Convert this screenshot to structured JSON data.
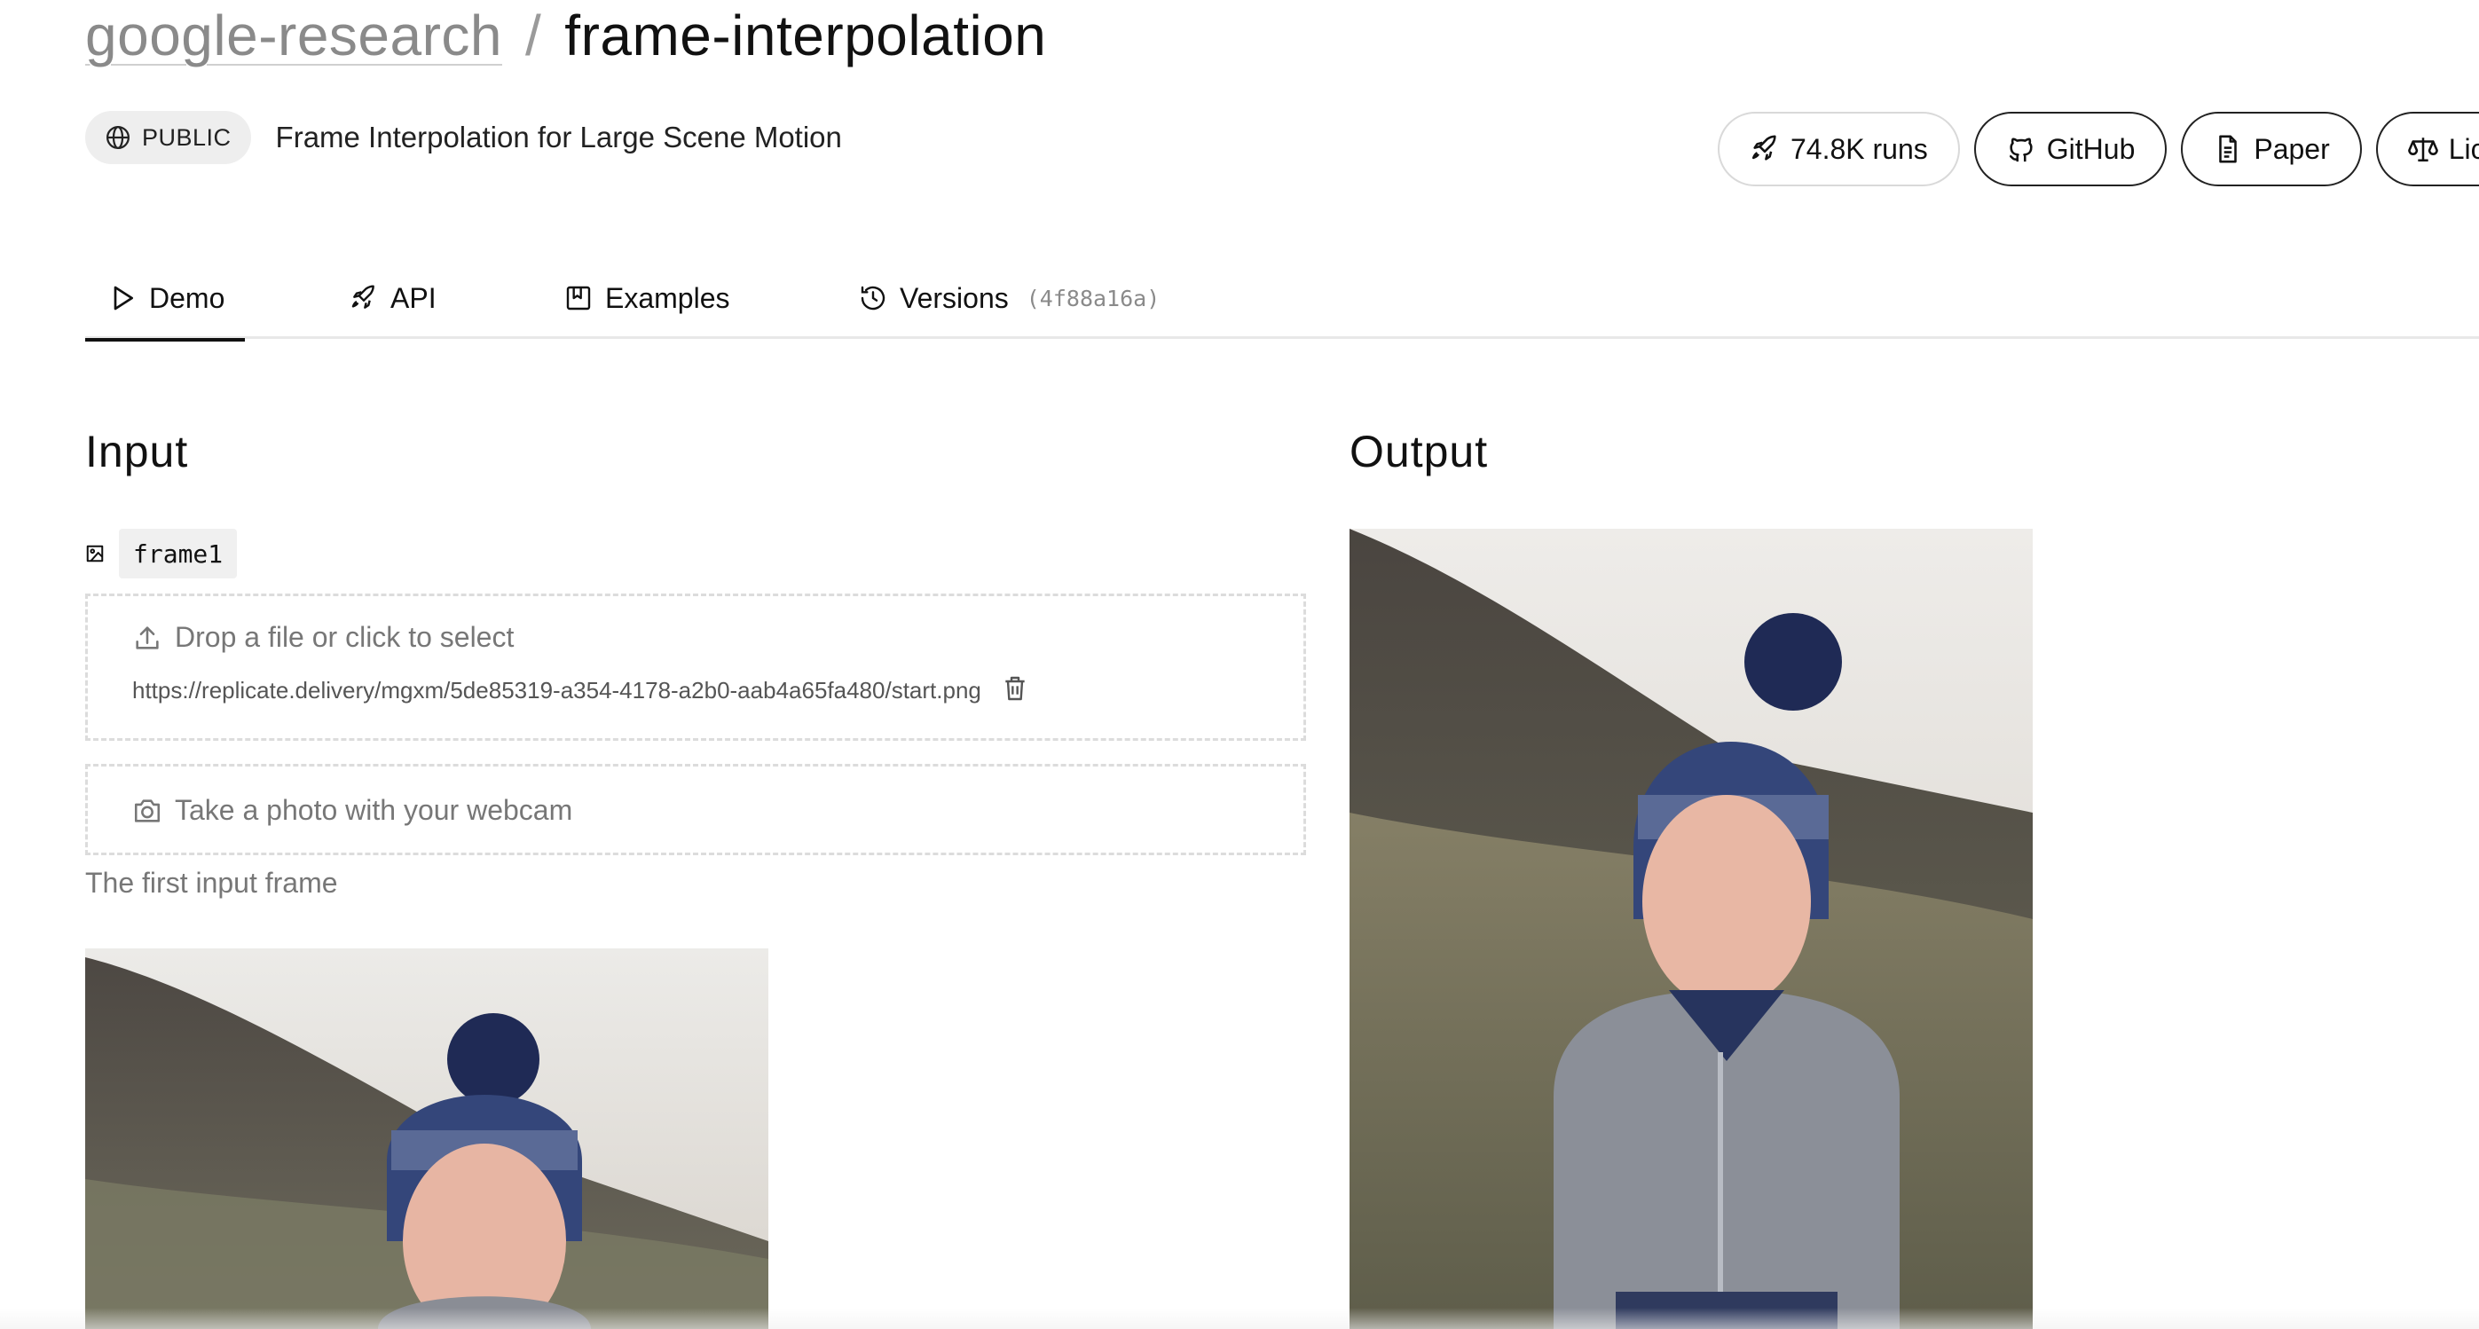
{
  "breadcrumb": {
    "owner": "google-research",
    "separator": "/",
    "model": "frame-interpolation"
  },
  "meta": {
    "visibility": "PUBLIC",
    "description": "Frame Interpolation for Large Scene Motion"
  },
  "actions": {
    "runs": "74.8K runs",
    "github": "GitHub",
    "paper": "Paper",
    "license": "Lic"
  },
  "tabs": [
    {
      "label": "Demo",
      "icon": "play-icon",
      "active": true
    },
    {
      "label": "API",
      "icon": "rocket-icon"
    },
    {
      "label": "Examples",
      "icon": "bookmark-icon"
    },
    {
      "label": "Versions",
      "icon": "history-icon",
      "hash": "(4f88a16a)"
    }
  ],
  "input": {
    "title": "Input",
    "field_name": "frame1",
    "drop_label": "Drop a file or click to select",
    "file_url": "https://replicate.delivery/mgxm/5de85319-a354-4178-a2b0-aab4a65fa480/start.png",
    "webcam_label": "Take a photo with your webcam",
    "help": "The first input frame"
  },
  "output": {
    "title": "Output"
  },
  "colors": {
    "text": "#111111",
    "muted": "#777777",
    "badge_bg": "#eeeeee",
    "border_dashed": "#dcdcdc"
  }
}
